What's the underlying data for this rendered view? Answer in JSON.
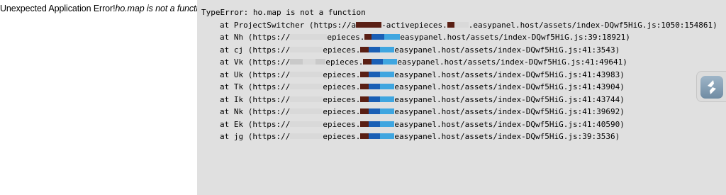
{
  "error": {
    "title": "Unexpected Application Error!",
    "message": "ho.map is not a function"
  },
  "stack": {
    "header": "TypeError: ho.map is not a function",
    "frames": [
      {
        "at": "at",
        "fn": "ProjectSwitcher",
        "pre": "(https://a",
        "mid": "-activepieces.",
        "host": ".easypanel.host/assets/index-DQwf5HiG.js:1050:154861)"
      },
      {
        "at": "at",
        "fn": "Nh",
        "pre": "(https://",
        "mid": "epieces.",
        "host": "easypanel.host/assets/index-DQwf5HiG.js:39:18921)"
      },
      {
        "at": "at",
        "fn": "cj",
        "pre": "(https://",
        "mid": "epieces.",
        "host": "easypanel.host/assets/index-DQwf5HiG.js:41:3543)"
      },
      {
        "at": "at",
        "fn": "Vk",
        "pre": "(https://",
        "mid": "epieces.",
        "host": "easypanel.host/assets/index-DQwf5HiG.js:41:49641)"
      },
      {
        "at": "at",
        "fn": "Uk",
        "pre": "(https://",
        "mid": "epieces.",
        "host": "easypanel.host/assets/index-DQwf5HiG.js:41:43983)"
      },
      {
        "at": "at",
        "fn": "Tk",
        "pre": "(https://",
        "mid": "epieces.",
        "host": "easypanel.host/assets/index-DQwf5HiG.js:41:43904)"
      },
      {
        "at": "at",
        "fn": "Ik",
        "pre": "(https://",
        "mid": "epieces.",
        "host": "easypanel.host/assets/index-DQwf5HiG.js:41:43744)"
      },
      {
        "at": "at",
        "fn": "Nk",
        "pre": "(https://",
        "mid": "epieces.",
        "host": "easypanel.host/assets/index-DQwf5HiG.js:41:39692)"
      },
      {
        "at": "at",
        "fn": "Ek",
        "pre": "(https://",
        "mid": "epieces.",
        "host": "easypanel.host/assets/index-DQwf5HiG.js:41:40590)"
      },
      {
        "at": "at",
        "fn": "jg",
        "pre": "(https://",
        "mid": "epieces.",
        "host": "easypanel.host/assets/index-DQwf5HiG.js:39:3536)"
      }
    ]
  },
  "widget": {
    "icon": "app-logo-icon",
    "colors": {
      "bg": "#dcdcdc",
      "icon": "#ffffff"
    }
  },
  "colors": {
    "page_bg": "#ffffff",
    "stack_bg": "#e0e0e0",
    "text": "#000000"
  }
}
